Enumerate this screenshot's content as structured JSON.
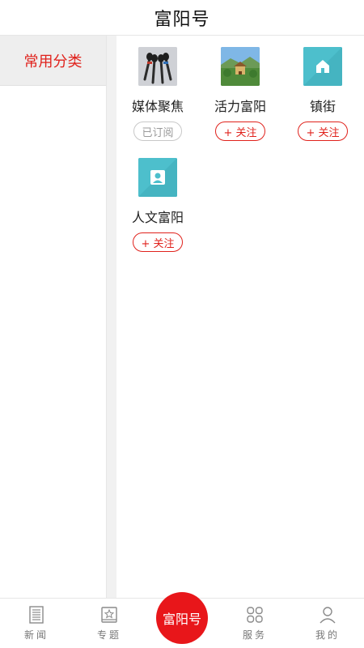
{
  "header": {
    "title": "富阳号"
  },
  "sidebar": {
    "categories": [
      {
        "label": "常用分类",
        "active": true
      }
    ]
  },
  "channels": [
    {
      "name": "媒体聚焦",
      "button": "已订阅",
      "subscribed": true,
      "icon": "microphones-photo"
    },
    {
      "name": "活力富阳",
      "button": "+ 关注",
      "subscribed": false,
      "icon": "scenery-photo"
    },
    {
      "name": "镇街",
      "button": "+ 关注",
      "subscribed": false,
      "icon": "home-icon"
    },
    {
      "name": "人文富阳",
      "button": "+ 关注",
      "subscribed": false,
      "icon": "person-icon"
    }
  ],
  "bottom_nav": {
    "items": [
      {
        "label": "新闻",
        "icon": "newspaper-icon"
      },
      {
        "label": "专题",
        "icon": "star-card-icon"
      },
      {
        "label": "服务",
        "icon": "grid-icon"
      },
      {
        "label": "我的",
        "icon": "user-icon"
      }
    ],
    "center_label": "富阳号"
  },
  "colors": {
    "accent": "#e0221c",
    "teal": "#4dbfcc",
    "center_button": "#e8161a"
  }
}
